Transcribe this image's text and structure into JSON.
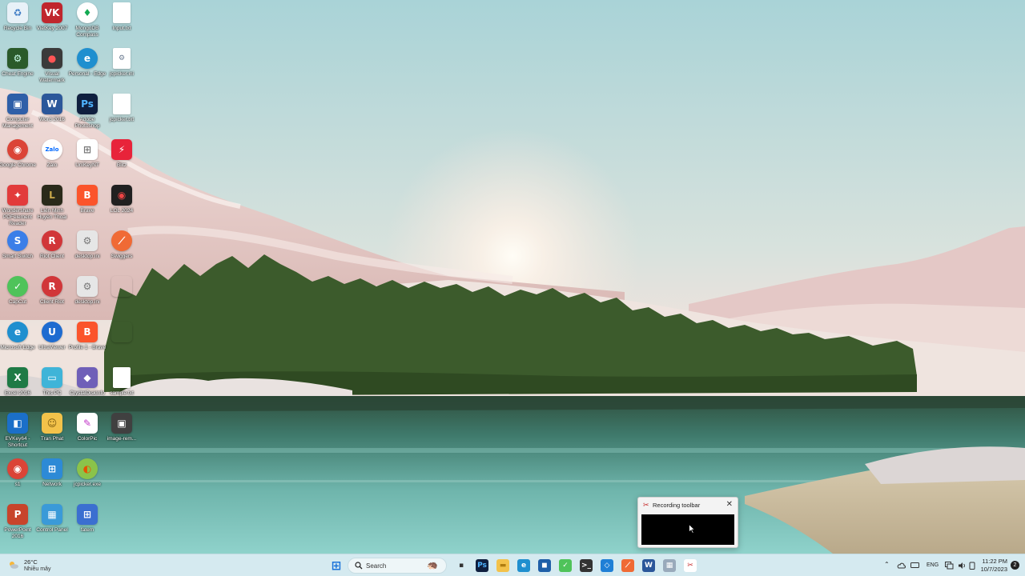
{
  "desktop": {
    "icons": [
      {
        "label": "Recycle Bin",
        "icon": "recycle-bin-icon",
        "glyph": "♻",
        "color": "#e8f1f8",
        "fg": "#3a79c4"
      },
      {
        "label": "Cheat Engine",
        "icon": "cheat-engine-icon",
        "glyph": "⚙",
        "color": "#2a5a2a",
        "fg": "#cfe"
      },
      {
        "label": "Computer Management",
        "icon": "computer-management-icon",
        "glyph": "▣",
        "color": "#2f5fa8",
        "fg": "#fff"
      },
      {
        "label": "Google Chrome",
        "icon": "chrome-icon",
        "glyph": "◉",
        "color": "#db4437",
        "fg": "#fff",
        "round": true
      },
      {
        "label": "Wondershare PDFelement Reader",
        "icon": "pdf-reader-icon",
        "glyph": "✦",
        "color": "#e23b3b",
        "fg": "#fff"
      },
      {
        "label": "Smart Switch",
        "icon": "smart-switch-icon",
        "glyph": "S",
        "color": "#3b7ee8",
        "fg": "#fff",
        "round": true
      },
      {
        "label": "CapCut",
        "icon": "capcut-icon",
        "glyph": "✓",
        "color": "#4fc35a",
        "fg": "#fff",
        "round": true
      },
      {
        "label": "Microsoft Edge",
        "icon": "edge-icon",
        "glyph": "e",
        "color": "#1f8fcf",
        "fg": "#fff",
        "round": true
      },
      {
        "label": "Excel 2016",
        "icon": "excel-icon",
        "glyph": "X",
        "color": "#1e7a45",
        "fg": "#fff"
      },
      {
        "label": "EVKey64 - Shortcut",
        "icon": "evkey-icon",
        "glyph": "◧",
        "color": "#1b6fc8",
        "fg": "#fff"
      },
      {
        "label": "s1",
        "icon": "chrome-icon",
        "glyph": "◉",
        "color": "#db4437",
        "fg": "#fff",
        "round": true
      },
      {
        "label": "PowerPoint 2016",
        "icon": "powerpoint-icon",
        "glyph": "P",
        "color": "#c8442b",
        "fg": "#fff"
      },
      {
        "label": "VietKey 2007",
        "icon": "vietkey-icon",
        "glyph": "VK",
        "color": "#c0262d",
        "fg": "#fff"
      },
      {
        "label": "Visual Watermark",
        "icon": "watermark-icon",
        "glyph": "●",
        "color": "#3a3a3a",
        "fg": "#f55"
      },
      {
        "label": "Word 2016",
        "icon": "word-icon",
        "glyph": "W",
        "color": "#2b579a",
        "fg": "#fff"
      },
      {
        "label": "Zalo",
        "icon": "zalo-icon",
        "glyph": "Zalo",
        "color": "#ffffff",
        "fg": "#0068ff",
        "round": true
      },
      {
        "label": "Liên Minh Huyền Thoại",
        "icon": "lol-icon",
        "glyph": "L",
        "color": "#2a2a1a",
        "fg": "#c9a94b"
      },
      {
        "label": "Riot Client",
        "icon": "riot-client-icon",
        "glyph": "R",
        "color": "#d13639",
        "fg": "#fff",
        "round": true
      },
      {
        "label": "Client Riot",
        "icon": "riot-client-icon",
        "glyph": "R",
        "color": "#d13639",
        "fg": "#fff",
        "round": true
      },
      {
        "label": "UltraViewer",
        "icon": "ultraviewer-icon",
        "glyph": "U",
        "color": "#1d6bd0",
        "fg": "#fff",
        "round": true
      },
      {
        "label": "This PC",
        "icon": "this-pc-icon",
        "glyph": "▭",
        "color": "#3fb4d8",
        "fg": "#fff"
      },
      {
        "label": "Tran Phat",
        "icon": "user-folder-icon",
        "glyph": "☺",
        "color": "#f3c24a",
        "fg": "#7a5a10"
      },
      {
        "label": "Network",
        "icon": "network-icon",
        "glyph": "⊞",
        "color": "#2d8ad6",
        "fg": "#fff"
      },
      {
        "label": "Control Panel",
        "icon": "control-panel-icon",
        "glyph": "▦",
        "color": "#3a9ad8",
        "fg": "#fff"
      },
      {
        "label": "MongoDB Compass",
        "icon": "mongodb-icon",
        "glyph": "♦",
        "color": "#ffffff",
        "fg": "#13aa52",
        "round": true
      },
      {
        "label": "Personal - Edge",
        "icon": "edge-icon",
        "glyph": "e",
        "color": "#1f8fcf",
        "fg": "#fff",
        "round": true
      },
      {
        "label": "Adobe Photoshop",
        "icon": "photoshop-icon",
        "glyph": "Ps",
        "color": "#0f1f3f",
        "fg": "#4fb3ff"
      },
      {
        "label": "UniKeyNT",
        "icon": "unikey-icon",
        "glyph": "⊞",
        "color": "#ffffff",
        "fg": "#777"
      },
      {
        "label": "Brave",
        "icon": "brave-icon",
        "glyph": "B",
        "color": "#fb542b",
        "fg": "#fff"
      },
      {
        "label": "desktop.ini",
        "icon": "settings-file-icon",
        "glyph": "⚙",
        "color": "#e6e6e6",
        "fg": "#777"
      },
      {
        "label": "desktop.ini",
        "icon": "settings-file-icon",
        "glyph": "⚙",
        "color": "#e6e6e6",
        "fg": "#777"
      },
      {
        "label": "Profile 1 - Brave",
        "icon": "brave-icon",
        "glyph": "B",
        "color": "#fb542b",
        "fg": "#fff"
      },
      {
        "label": "CrystalDiskInfo",
        "icon": "crystaldisk-icon",
        "glyph": "◆",
        "color": "#6f5fb8",
        "fg": "#fff"
      },
      {
        "label": "ColorPic",
        "icon": "colorpic-icon",
        "glyph": "✎",
        "color": "#ffffff",
        "fg": "#c236c8"
      },
      {
        "label": "jcpicker.exe",
        "icon": "jcpicker-icon",
        "glyph": "◐",
        "color": "#8bc34a",
        "fg": "#e65100",
        "round": true
      },
      {
        "label": "fatem",
        "icon": "fatem-icon",
        "glyph": "⊞",
        "color": "#3b6fd0",
        "fg": "#fff"
      },
      {
        "label": "Input.txt",
        "icon": "text-file-icon",
        "glyph": "",
        "doc": true
      },
      {
        "label": "jcpicker.ini",
        "icon": "ini-file-icon",
        "glyph": "⚙",
        "doc": true
      },
      {
        "label": "jcpicker.txt",
        "icon": "text-file-icon",
        "glyph": "",
        "doc": true
      },
      {
        "label": "Blitz",
        "icon": "blitz-icon",
        "glyph": "⚡",
        "color": "#e8233a",
        "fg": "#fff"
      },
      {
        "label": "LOL 2024",
        "icon": "lol-2024-icon",
        "glyph": "◉",
        "color": "#202020",
        "fg": "#e44"
      },
      {
        "label": "Swiggers",
        "icon": "swiggers-icon",
        "glyph": "⟋",
        "color": "#f06a35",
        "fg": "#fff",
        "round": true
      },
      {
        "label": "",
        "icon": "blank-icon",
        "glyph": "",
        "color": "transparent",
        "fg": "#fff"
      },
      {
        "label": "",
        "icon": "blank-icon",
        "glyph": "",
        "color": "transparent",
        "fg": "#fff"
      },
      {
        "label": "sample.txt",
        "icon": "text-file-icon",
        "glyph": "",
        "doc": true
      },
      {
        "label": "image-rem...",
        "icon": "image-remover-icon",
        "glyph": "▣",
        "color": "#404040",
        "fg": "#fff"
      }
    ]
  },
  "recording_toolbar": {
    "title": "Recording toolbar",
    "close_glyph": "✕",
    "app_glyph": "✂"
  },
  "taskbar": {
    "weather_temp": "26°C",
    "weather_desc": "Nhiều mây",
    "search_placeholder": "Search",
    "search_art": "🦔",
    "apps": [
      {
        "name": "start-button",
        "glyph": "⊞",
        "bg": "transparent",
        "fg": "#1a73d9"
      },
      {
        "name": "task-view-button",
        "glyph": "▪",
        "bg": "transparent",
        "fg": "#333"
      },
      {
        "name": "photoshop-taskbar-button",
        "glyph": "Ps",
        "bg": "#0f1f3f",
        "fg": "#4fb3ff"
      },
      {
        "name": "file-explorer-button",
        "glyph": "▬",
        "bg": "#f3c24a",
        "fg": "#b07d10"
      },
      {
        "name": "edge-taskbar-button",
        "glyph": "e",
        "bg": "#1f8fcf",
        "fg": "#fff"
      },
      {
        "name": "store-taskbar-button",
        "glyph": "◼",
        "bg": "#1f5fa8",
        "fg": "#fff"
      },
      {
        "name": "capcut-taskbar-button",
        "glyph": "✓",
        "bg": "#4fc35a",
        "fg": "#fff"
      },
      {
        "name": "terminal-taskbar-button",
        "glyph": ">_",
        "bg": "#333",
        "fg": "#fff"
      },
      {
        "name": "vscode-taskbar-button",
        "glyph": "◇",
        "bg": "#1f7fd6",
        "fg": "#fff"
      },
      {
        "name": "swiggers-taskbar-button",
        "glyph": "⟋",
        "bg": "#f06a35",
        "fg": "#fff"
      },
      {
        "name": "word-taskbar-button",
        "glyph": "W",
        "bg": "#2b579a",
        "fg": "#fff"
      },
      {
        "name": "control-taskbar-button",
        "glyph": "▦",
        "bg": "#9ab",
        "fg": "#fff"
      },
      {
        "name": "snipping-tool-button",
        "glyph": "✂",
        "bg": "#fff",
        "fg": "#c62828"
      }
    ],
    "tray": {
      "chevron": "⌃",
      "lang": "ENG",
      "time": "11:22 PM",
      "date": "10/7/2023",
      "notif_count": "2"
    }
  }
}
